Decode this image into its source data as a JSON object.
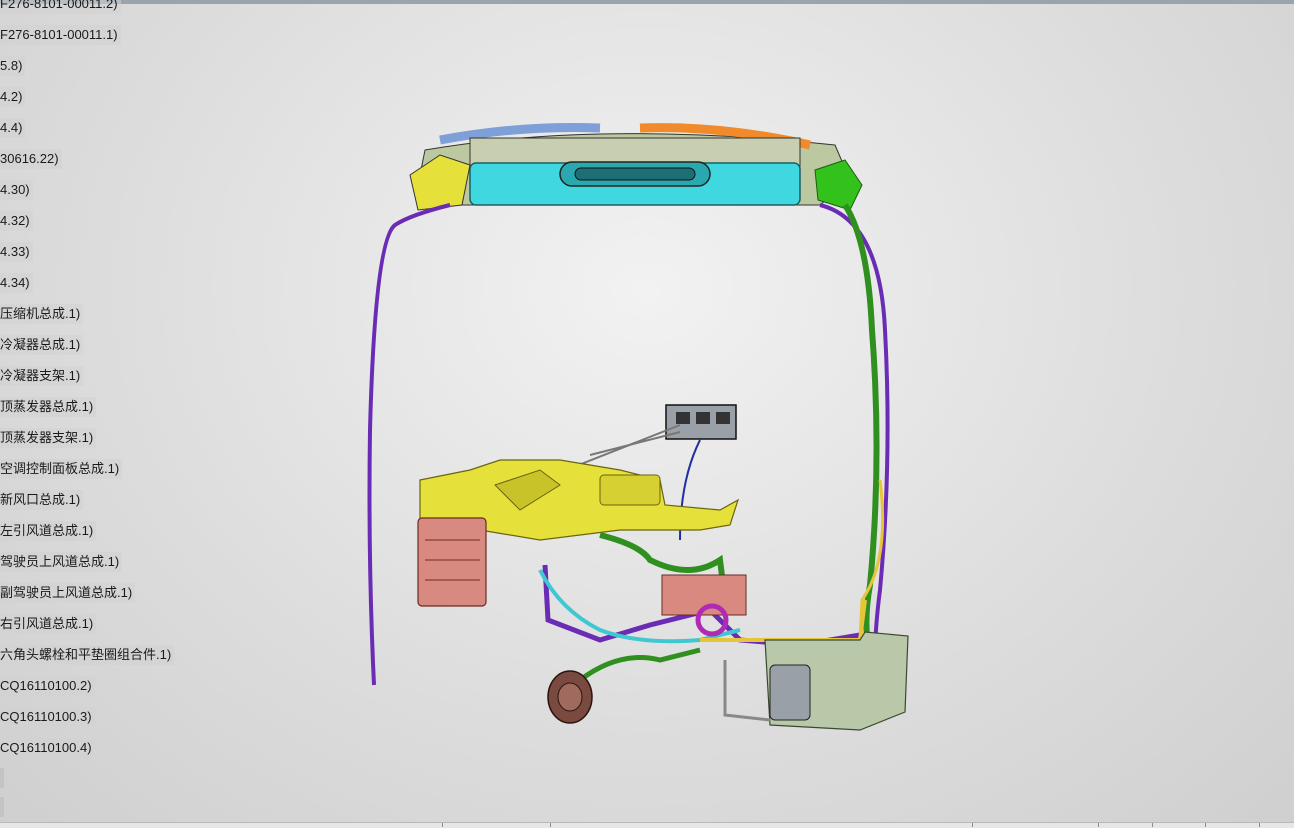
{
  "feature_tree": {
    "items": [
      {
        "label": "F276-8101-00011.2)"
      },
      {
        "label": "F276-8101-00011.1)"
      },
      {
        "label": "5.8)"
      },
      {
        "label": "4.2)"
      },
      {
        "label": "4.4)"
      },
      {
        "label": "30616.22)"
      },
      {
        "label": "4.30)"
      },
      {
        "label": "4.32)"
      },
      {
        "label": "4.33)"
      },
      {
        "label": "4.34)"
      },
      {
        "label": "压缩机总成.1)"
      },
      {
        "label": "冷凝器总成.1)"
      },
      {
        "label": "冷凝器支架.1)"
      },
      {
        "label": "顶蒸发器总成.1)"
      },
      {
        "label": "顶蒸发器支架.1)"
      },
      {
        "label": "空调控制面板总成.1)"
      },
      {
        "label": "新风口总成.1)"
      },
      {
        "label": "左引风道总成.1)"
      },
      {
        "label": "驾驶员上风道总成.1)"
      },
      {
        "label": "副驾驶员上风道总成.1)"
      },
      {
        "label": "右引风道总成.1)"
      },
      {
        "label": "六角头螺栓和平垫圈组合件.1)"
      },
      {
        "label": "CQ16110100.2)"
      },
      {
        "label": "CQ16110100.3)"
      },
      {
        "label": "CQ16110100.4)"
      }
    ]
  },
  "colors": {
    "evaporator_housing": "#3fd8e0",
    "pipe_purple": "#6a2bb5",
    "pipe_green": "#2f8f1f",
    "air_duct_yellow": "#e6e03a",
    "heater_core": "#d98a80",
    "compressor": "#7a4a40"
  }
}
